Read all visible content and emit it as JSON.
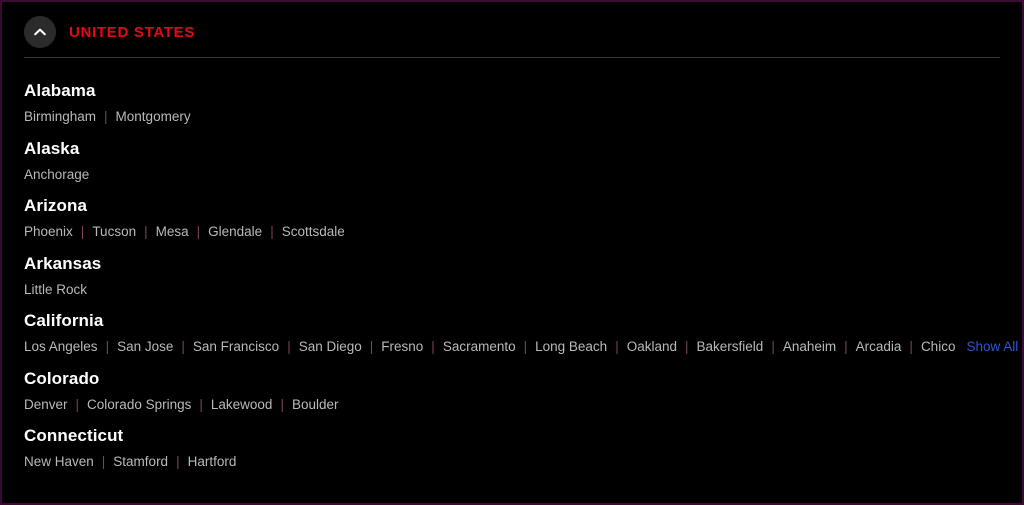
{
  "header": {
    "collapse_icon": "chevron-up-icon",
    "title": "UNITED STATES"
  },
  "separator": "|",
  "colors": {
    "background": "#000000",
    "border": "#3d0a33",
    "title_red": "#e50914",
    "state_name": "#ffffff",
    "city_text": "#b8b8b8",
    "separator": "#7a4450",
    "link_blue": "#2b56d4",
    "divider": "#3a3a3a",
    "icon_circle": "#2b2b2b"
  },
  "states": [
    {
      "name": "Alabama",
      "cities": [
        "Birmingham",
        "Montgomery"
      ],
      "show_all": null
    },
    {
      "name": "Alaska",
      "cities": [
        "Anchorage"
      ],
      "show_all": null
    },
    {
      "name": "Arizona",
      "cities": [
        "Phoenix",
        "Tucson",
        "Mesa",
        "Glendale",
        "Scottsdale"
      ],
      "show_all": null
    },
    {
      "name": "Arkansas",
      "cities": [
        "Little Rock"
      ],
      "show_all": null
    },
    {
      "name": "California",
      "cities": [
        "Los Angeles",
        "San Jose",
        "San Francisco",
        "San Diego",
        "Fresno",
        "Sacramento",
        "Long Beach",
        "Oakland",
        "Bakersfield",
        "Anaheim",
        "Arcadia",
        "Chico"
      ],
      "show_all": "Show All"
    },
    {
      "name": "Colorado",
      "cities": [
        "Denver",
        "Colorado Springs",
        "Lakewood",
        "Boulder"
      ],
      "show_all": null
    },
    {
      "name": "Connecticut",
      "cities": [
        "New Haven",
        "Stamford",
        "Hartford"
      ],
      "show_all": null
    }
  ]
}
